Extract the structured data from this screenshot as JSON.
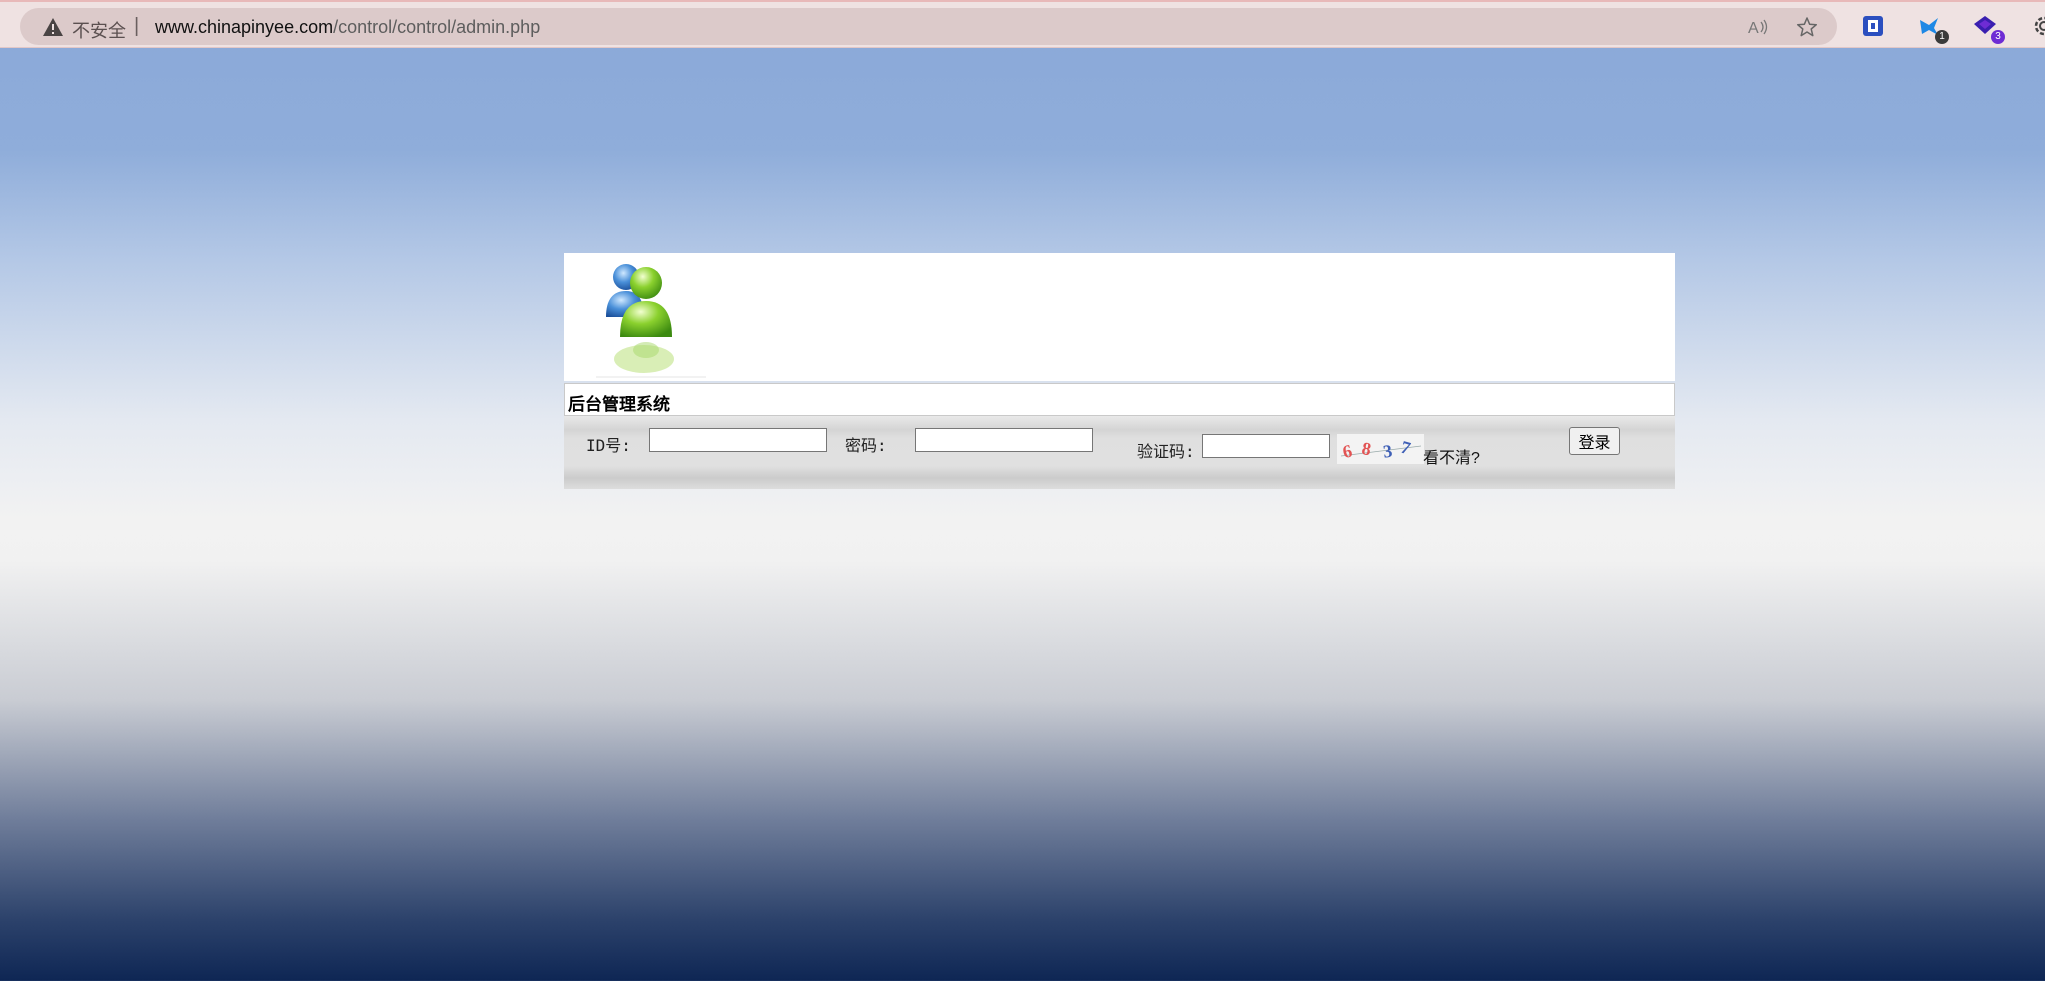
{
  "browser": {
    "security_label": "不安全",
    "separator": "|",
    "url_domain": "www.chinapinyee.com",
    "url_path": "/control/control/admin.php",
    "extensions": [
      {
        "name": "extension-1",
        "badge": ""
      },
      {
        "name": "extension-2",
        "badge": "1"
      },
      {
        "name": "extension-3",
        "badge": "3"
      }
    ]
  },
  "login": {
    "title": "后台管理系统",
    "id_label": "ID号:",
    "id_value": "",
    "password_label": "密码:",
    "password_value": "",
    "captcha_label": "验证码:",
    "captcha_value": "",
    "captcha_image_text": "6837",
    "captcha_hint": "看不清?",
    "login_button": "登录"
  },
  "colors": {
    "accent_blue": "#2b4fbf",
    "badge_gray": "#3b3b3b",
    "badge_purple": "#6e2cd4"
  }
}
